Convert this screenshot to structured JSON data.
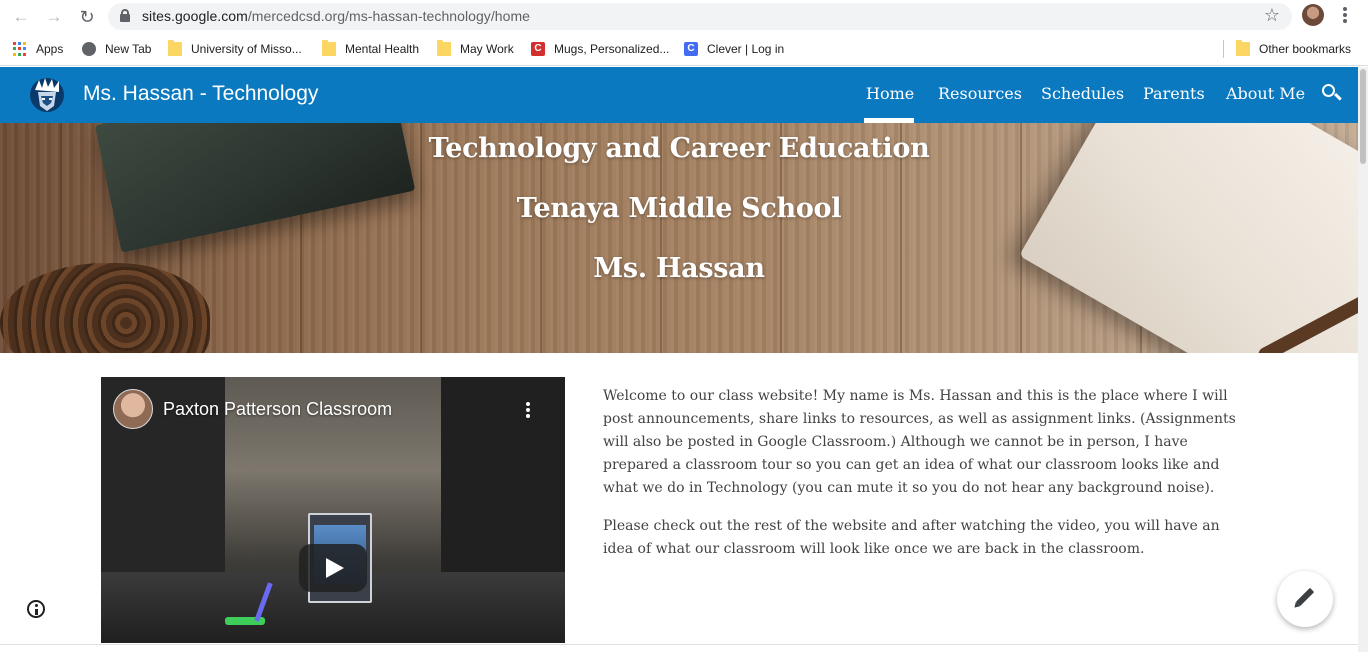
{
  "browser": {
    "url_host": "sites.google.com",
    "url_path": "/mercedcsd.org/ms-hassan-technology/home",
    "bookmarks": [
      {
        "label": "Apps",
        "icon": "apps-grid-icon"
      },
      {
        "label": "New Tab",
        "icon": "globe-icon"
      },
      {
        "label": "University of Misso...",
        "icon": "folder-icon"
      },
      {
        "label": "Mental Health",
        "icon": "folder-icon"
      },
      {
        "label": "May Work",
        "icon": "folder-icon"
      },
      {
        "label": "Mugs, Personalized...",
        "icon": "mugs-favicon"
      },
      {
        "label": "Clever | Log in",
        "icon": "clever-favicon"
      }
    ],
    "other_bookmarks": "Other bookmarks",
    "mugs_glyph": "C",
    "clever_glyph": "C"
  },
  "site": {
    "title": "Ms. Hassan - Technology",
    "nav": [
      "Home",
      "Resources",
      "Schedules",
      "Parents",
      "About Me"
    ],
    "active_nav": "Home",
    "brand_color": "#0a79c0"
  },
  "hero": {
    "line1": "Technology and Career Education",
    "line2": "Tenaya Middle School",
    "line3": "Ms. Hassan"
  },
  "video": {
    "title": "Paxton Patterson Classroom"
  },
  "article": {
    "p1": "Welcome to our class website! My name is Ms. Hassan and this is the place where I will post announcements, share links to resources, as well as assignment links. (Assignments will also be posted in Google Classroom.) Although we cannot be in person, I have prepared a classroom tour so you can get an idea of what our classroom looks like and what we do in Technology (you can mute it so you do not hear any background noise).",
    "p2": "Please check out the rest of the website and after watching the video, you will have an idea of what our classroom will look like once we are back in the classroom."
  }
}
